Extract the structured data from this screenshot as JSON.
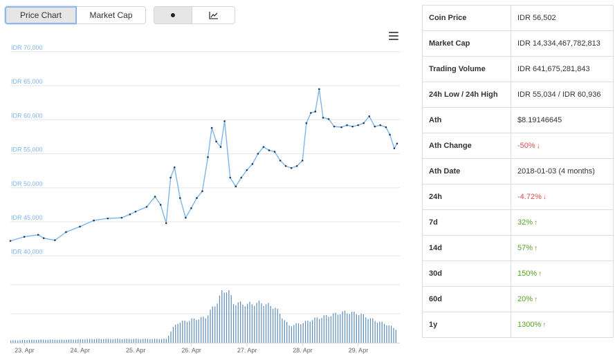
{
  "toolbar": {
    "price_chart": "Price Chart",
    "market_cap": "Market Cap",
    "dot_mode_icon": "dot-icon",
    "line_mode_icon": "line-chart-icon",
    "menu_icon": "hamburger-menu-icon"
  },
  "chart_data": {
    "type": "line",
    "title": "",
    "y_tick_labels": [
      "IDR 40,000",
      "IDR 45,000",
      "IDR 50,000",
      "IDR 55,000",
      "IDR 60,000",
      "IDR 65,000",
      "IDR 70,000"
    ],
    "y_ticks": [
      40000,
      45000,
      50000,
      55000,
      60000,
      65000,
      70000
    ],
    "ylim": [
      38000,
      71500
    ],
    "x_tick_labels": [
      "23. Apr",
      "24. Apr",
      "25. Apr",
      "26. Apr",
      "27. Apr",
      "28. Apr",
      "29. Apr"
    ],
    "x_ticks": [
      0.25,
      1.25,
      2.25,
      3.25,
      4.25,
      5.25,
      6.25
    ],
    "xlim": [
      0,
      7.0
    ],
    "series_color": "#7cb5ec",
    "volume_color": "#5b8cb8",
    "grid": true,
    "price_series": [
      [
        0.0,
        42200
      ],
      [
        0.25,
        42800
      ],
      [
        0.5,
        43100
      ],
      [
        0.6,
        42600
      ],
      [
        0.8,
        42300
      ],
      [
        1.0,
        43500
      ],
      [
        1.25,
        44300
      ],
      [
        1.5,
        45200
      ],
      [
        1.75,
        45500
      ],
      [
        2.0,
        45600
      ],
      [
        2.15,
        46100
      ],
      [
        2.25,
        46500
      ],
      [
        2.45,
        47200
      ],
      [
        2.6,
        48700
      ],
      [
        2.7,
        47500
      ],
      [
        2.8,
        44800
      ],
      [
        2.88,
        51500
      ],
      [
        2.95,
        53000
      ],
      [
        3.05,
        48500
      ],
      [
        3.15,
        45600
      ],
      [
        3.25,
        47000
      ],
      [
        3.35,
        48500
      ],
      [
        3.45,
        49500
      ],
      [
        3.55,
        54500
      ],
      [
        3.62,
        58800
      ],
      [
        3.7,
        56800
      ],
      [
        3.78,
        56000
      ],
      [
        3.85,
        59800
      ],
      [
        3.95,
        51500
      ],
      [
        4.05,
        50200
      ],
      [
        4.15,
        51500
      ],
      [
        4.25,
        52600
      ],
      [
        4.35,
        53500
      ],
      [
        4.45,
        55000
      ],
      [
        4.55,
        56000
      ],
      [
        4.65,
        55500
      ],
      [
        4.75,
        55300
      ],
      [
        4.85,
        54000
      ],
      [
        4.95,
        53200
      ],
      [
        5.05,
        52900
      ],
      [
        5.15,
        53200
      ],
      [
        5.25,
        54000
      ],
      [
        5.32,
        59500
      ],
      [
        5.4,
        61000
      ],
      [
        5.48,
        61200
      ],
      [
        5.55,
        64500
      ],
      [
        5.62,
        60300
      ],
      [
        5.72,
        60100
      ],
      [
        5.82,
        59000
      ],
      [
        5.95,
        58900
      ],
      [
        6.05,
        59200
      ],
      [
        6.15,
        59000
      ],
      [
        6.25,
        59200
      ],
      [
        6.35,
        59500
      ],
      [
        6.45,
        60500
      ],
      [
        6.55,
        59000
      ],
      [
        6.65,
        59200
      ],
      [
        6.75,
        58900
      ],
      [
        6.82,
        57800
      ],
      [
        6.9,
        55800
      ],
      [
        6.95,
        56500
      ]
    ],
    "volume_series": [
      [
        0.0,
        3
      ],
      [
        0.5,
        4
      ],
      [
        1.0,
        4
      ],
      [
        1.5,
        5
      ],
      [
        2.0,
        5
      ],
      [
        2.5,
        5
      ],
      [
        2.8,
        5
      ],
      [
        2.9,
        18
      ],
      [
        3.0,
        26
      ],
      [
        3.25,
        30
      ],
      [
        3.5,
        33
      ],
      [
        3.7,
        52
      ],
      [
        3.8,
        66
      ],
      [
        3.9,
        70
      ],
      [
        4.0,
        52
      ],
      [
        4.25,
        50
      ],
      [
        4.5,
        52
      ],
      [
        4.75,
        46
      ],
      [
        5.0,
        22
      ],
      [
        5.25,
        26
      ],
      [
        5.5,
        32
      ],
      [
        5.75,
        36
      ],
      [
        6.0,
        40
      ],
      [
        6.25,
        38
      ],
      [
        6.5,
        30
      ],
      [
        6.75,
        24
      ],
      [
        6.95,
        17
      ]
    ]
  },
  "stats": {
    "coin_price": {
      "label": "Coin Price",
      "value": "IDR 56,502"
    },
    "market_cap": {
      "label": "Market Cap",
      "value": "IDR 14,334,467,782,813"
    },
    "volume": {
      "label": "Trading Volume",
      "value": "IDR 641,675,281,843"
    },
    "low_high": {
      "label": "24h Low / 24h High",
      "value": "IDR 55,034 / IDR 60,936"
    },
    "ath": {
      "label": "Ath",
      "value": "$8.19146645"
    },
    "ath_change": {
      "label": "Ath Change",
      "value": "-50%",
      "arrow": "↓",
      "color": "#e14d4d"
    },
    "ath_date": {
      "label": "Ath Date",
      "value": "2018-01-03 (4 months)"
    },
    "ch_24h": {
      "label": "24h",
      "value": "-4.72%",
      "arrow": "↓",
      "color": "#e14d4d"
    },
    "ch_7d": {
      "label": "7d",
      "value": "32%",
      "arrow": "↑",
      "color": "#53a523"
    },
    "ch_14d": {
      "label": "14d",
      "value": "57%",
      "arrow": "↑",
      "color": "#53a523"
    },
    "ch_30d": {
      "label": "30d",
      "value": "150%",
      "arrow": "↑",
      "color": "#53a523"
    },
    "ch_60d": {
      "label": "60d",
      "value": "20%",
      "arrow": "↑",
      "color": "#53a523"
    },
    "ch_1y": {
      "label": "1y",
      "value": "1300%",
      "arrow": "↑",
      "color": "#53a523"
    }
  }
}
